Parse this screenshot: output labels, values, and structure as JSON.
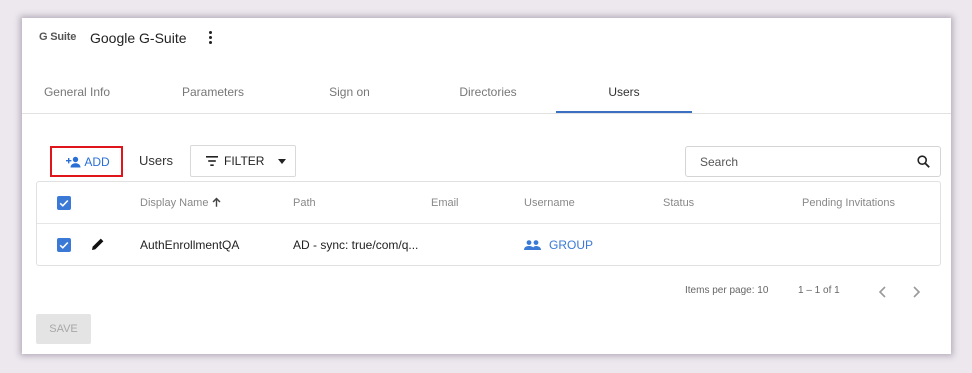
{
  "app": {
    "logo_text": "G Suite",
    "name": "Google G-Suite"
  },
  "tabs": [
    {
      "label": "General Info",
      "active": false
    },
    {
      "label": "Parameters",
      "active": false
    },
    {
      "label": "Sign on",
      "active": false
    },
    {
      "label": "Directories",
      "active": false
    },
    {
      "label": "Users",
      "active": true
    }
  ],
  "toolbar": {
    "add_label": "ADD",
    "users_label": "Users",
    "filter_label": "FILTER",
    "search_placeholder": "Search"
  },
  "table": {
    "columns": [
      "Display Name",
      "Path",
      "Email",
      "Username",
      "Status",
      "Pending Invitations"
    ],
    "sort_column": "Display Name",
    "sort_direction": "ascending",
    "rows": [
      {
        "selected": true,
        "display_name": "AuthEnrollmentQA",
        "path": "AD - sync: true/com/q...",
        "email": "",
        "username": "GROUP",
        "status": "",
        "pending_invitations": ""
      }
    ]
  },
  "paginator": {
    "items_per_page_label": "Items per page: 10",
    "range_label": "1 – 1 of 1"
  },
  "footer": {
    "save_label": "SAVE"
  },
  "colors": {
    "accent": "#3a7ad6",
    "highlight_border": "#e0141b",
    "tab_underline": "#3a6fc4"
  },
  "icons": [
    "kebab-menu-icon",
    "add-user-icon",
    "filter-icon",
    "caret-down-icon",
    "search-icon",
    "checkbox-checked-icon",
    "arrow-up-icon",
    "pencil-icon",
    "group-icon",
    "chevron-left-icon",
    "chevron-right-icon"
  ]
}
